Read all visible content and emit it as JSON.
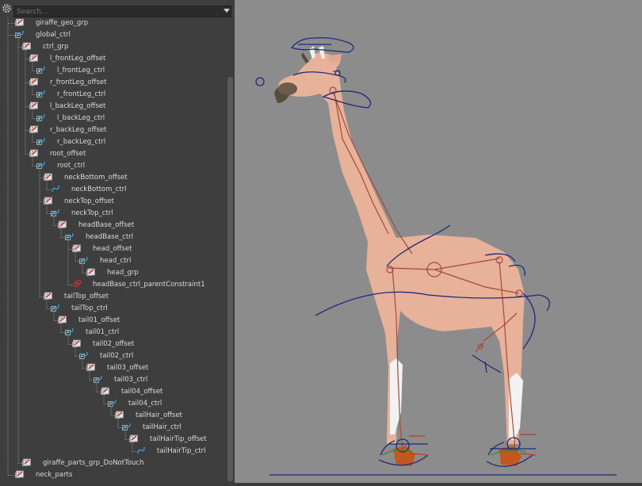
{
  "search": {
    "placeholder": "Search..."
  },
  "outliner": {
    "items": [
      {
        "label": "giraffe_geo_grp",
        "type": "group",
        "depth": 0,
        "expanded": false
      },
      {
        "label": "global_ctrl",
        "type": "ctrl",
        "depth": 0,
        "expanded": true
      },
      {
        "label": "ctrl_grp",
        "type": "group",
        "depth": 1,
        "expanded": true
      },
      {
        "label": "l_frontLeg_offset",
        "type": "group",
        "depth": 2,
        "expanded": true
      },
      {
        "label": "l_frontLeg_ctrl",
        "type": "ctrl",
        "depth": 3,
        "expanded": false
      },
      {
        "label": "r_frontLeg_offset",
        "type": "group",
        "depth": 2,
        "expanded": true
      },
      {
        "label": "r_frontLeg_ctrl",
        "type": "ctrl",
        "depth": 3,
        "expanded": false
      },
      {
        "label": "l_backLeg_offset",
        "type": "group",
        "depth": 2,
        "expanded": true
      },
      {
        "label": "l_backLeg_ctrl",
        "type": "ctrl",
        "depth": 3,
        "expanded": false
      },
      {
        "label": "r_backLeg_offset",
        "type": "group",
        "depth": 2,
        "expanded": true
      },
      {
        "label": "r_backLeg_ctrl",
        "type": "ctrl",
        "depth": 3,
        "expanded": false
      },
      {
        "label": "root_offset",
        "type": "group",
        "depth": 2,
        "expanded": true
      },
      {
        "label": "root_ctrl",
        "type": "ctrl",
        "depth": 3,
        "expanded": true
      },
      {
        "label": "neckBottom_offset",
        "type": "group",
        "depth": 4,
        "expanded": true
      },
      {
        "label": "neckBottom_ctrl",
        "type": "ctrl",
        "depth": 5,
        "expanded": null
      },
      {
        "label": "neckTop_offset",
        "type": "group",
        "depth": 4,
        "expanded": true
      },
      {
        "label": "neckTop_ctrl",
        "type": "ctrl",
        "depth": 5,
        "expanded": true
      },
      {
        "label": "headBase_offset",
        "type": "group",
        "depth": 6,
        "expanded": true
      },
      {
        "label": "headBase_ctrl",
        "type": "ctrl",
        "depth": 7,
        "expanded": true
      },
      {
        "label": "head_offset",
        "type": "group",
        "depth": 8,
        "expanded": true
      },
      {
        "label": "head_ctrl",
        "type": "ctrl",
        "depth": 9,
        "expanded": true
      },
      {
        "label": "head_grp",
        "type": "group",
        "depth": 10,
        "expanded": false
      },
      {
        "label": "headBase_ctrl_parentConstraint1",
        "type": "constraint",
        "depth": 8,
        "expanded": null
      },
      {
        "label": "tailTop_offset",
        "type": "group",
        "depth": 4,
        "expanded": true
      },
      {
        "label": "tailTop_ctrl",
        "type": "ctrl",
        "depth": 5,
        "expanded": true
      },
      {
        "label": "tail01_offset",
        "type": "group",
        "depth": 6,
        "expanded": true
      },
      {
        "label": "tail01_ctrl",
        "type": "ctrl",
        "depth": 7,
        "expanded": true
      },
      {
        "label": "tail02_offset",
        "type": "group",
        "depth": 8,
        "expanded": true
      },
      {
        "label": "tail02_ctrl",
        "type": "ctrl",
        "depth": 9,
        "expanded": true
      },
      {
        "label": "tail03_offset",
        "type": "group",
        "depth": 10,
        "expanded": true
      },
      {
        "label": "tail03_ctrl",
        "type": "ctrl",
        "depth": 11,
        "expanded": true
      },
      {
        "label": "tail04_offset",
        "type": "group",
        "depth": 12,
        "expanded": true
      },
      {
        "label": "tail04_ctrl",
        "type": "ctrl",
        "depth": 13,
        "expanded": true
      },
      {
        "label": "tailHair_offset",
        "type": "group",
        "depth": 14,
        "expanded": true
      },
      {
        "label": "tailHair_ctrl",
        "type": "ctrl",
        "depth": 15,
        "expanded": true
      },
      {
        "label": "tailHairTip_offset",
        "type": "group",
        "depth": 16,
        "expanded": true
      },
      {
        "label": "tailHairTip_ctrl",
        "type": "ctrl",
        "depth": 17,
        "expanded": null
      },
      {
        "label": "giraffe_parts_grp_DoNotTouch",
        "type": "group",
        "depth": 1,
        "expanded": false
      },
      {
        "label": "neck_parts",
        "type": "group",
        "depth": 0,
        "expanded": false
      }
    ]
  },
  "icons": {
    "group": "transform-group-icon",
    "ctrl": "nurbs-curve-icon",
    "constraint": "parent-constraint-icon",
    "options": "outliner-options-icon"
  },
  "colors": {
    "panel": "#3e3e3e",
    "viewport": "#8c8c8c",
    "giraffe_body": "#e8b199",
    "curve_blue": "#1e2a78",
    "joint_red": "#a24a3a",
    "hoof_orange": "#c2571f"
  }
}
